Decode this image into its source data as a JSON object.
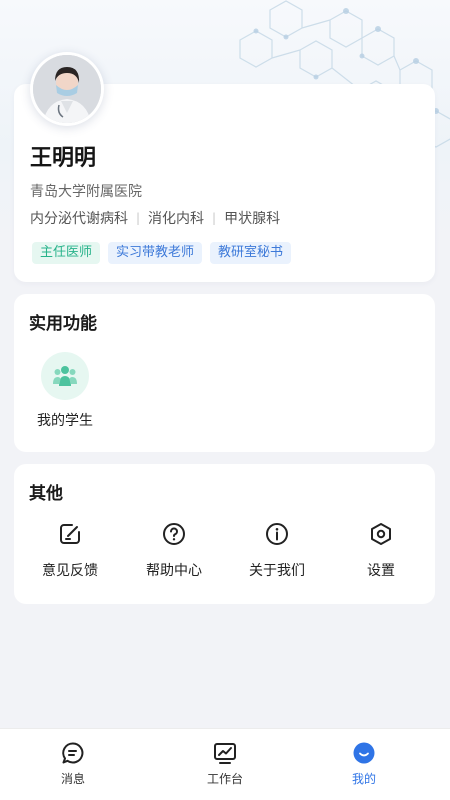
{
  "profile": {
    "name": "王明明",
    "hospital": "青岛大学附属医院",
    "departments": [
      "内分泌代谢病科",
      "消化内科",
      "甲状腺科"
    ],
    "tags": [
      {
        "label": "主任医师",
        "style": "green"
      },
      {
        "label": "实习带教老师",
        "style": "blue"
      },
      {
        "label": "教研室秘书",
        "style": "blue"
      }
    ]
  },
  "features": {
    "title": "实用功能",
    "items": [
      {
        "label": "我的学生",
        "icon": "students-icon"
      }
    ]
  },
  "others": {
    "title": "其他",
    "items": [
      {
        "label": "意见反馈",
        "icon": "feedback-icon"
      },
      {
        "label": "帮助中心",
        "icon": "help-icon"
      },
      {
        "label": "关于我们",
        "icon": "info-icon"
      },
      {
        "label": "设置",
        "icon": "settings-icon"
      }
    ]
  },
  "tabbar": {
    "items": [
      {
        "label": "消息",
        "icon": "message-icon",
        "active": false
      },
      {
        "label": "工作台",
        "icon": "dashboard-icon",
        "active": false
      },
      {
        "label": "我的",
        "icon": "profile-icon",
        "active": true
      }
    ]
  },
  "colors": {
    "accent": "#2f74e6",
    "green_tag_text": "#27b38a",
    "blue_tag_text": "#3e7ad9",
    "page_bg": "#f2f3f7"
  }
}
